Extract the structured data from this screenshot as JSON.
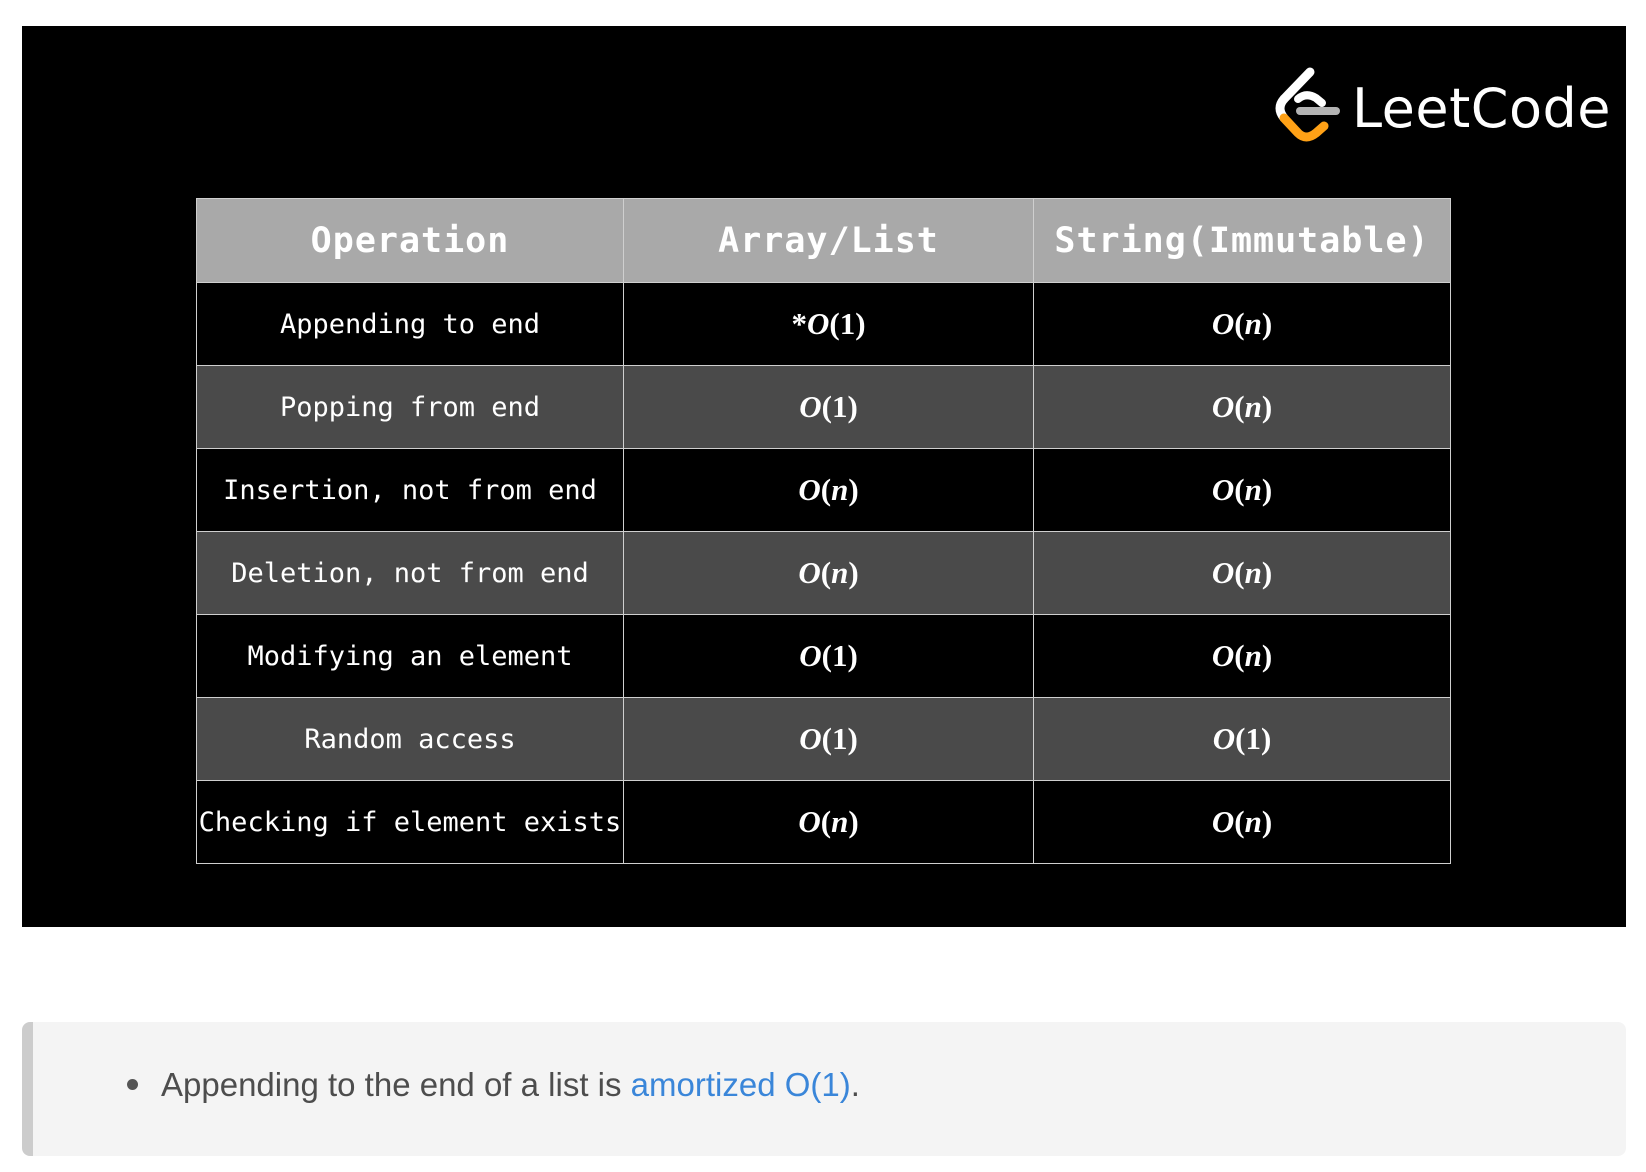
{
  "banner": {
    "logo_text": "LeetCode",
    "background": "#000000",
    "accent_orange": "#FFA116"
  },
  "table": {
    "headers": [
      "Operation",
      "Array/List",
      "String(Immutable)"
    ],
    "rows": [
      {
        "operation": "Appending to end",
        "array_prefix": "*",
        "array_o": "O",
        "array_arg": "1",
        "string_o": "O",
        "string_arg": "n"
      },
      {
        "operation": "Popping from end",
        "array_prefix": "",
        "array_o": "O",
        "array_arg": "1",
        "string_o": "O",
        "string_arg": "n"
      },
      {
        "operation": "Insertion, not from end",
        "array_prefix": "",
        "array_o": "O",
        "array_arg": "n",
        "string_o": "O",
        "string_arg": "n"
      },
      {
        "operation": "Deletion, not from end",
        "array_prefix": "",
        "array_o": "O",
        "array_arg": "n",
        "string_o": "O",
        "string_arg": "n"
      },
      {
        "operation": "Modifying an element",
        "array_prefix": "",
        "array_o": "O",
        "array_arg": "1",
        "string_o": "O",
        "string_arg": "n"
      },
      {
        "operation": "Random access",
        "array_prefix": "",
        "array_o": "O",
        "array_arg": "1",
        "string_o": "O",
        "string_arg": "1"
      },
      {
        "operation": "Checking if element exists",
        "array_prefix": "",
        "array_o": "O",
        "array_arg": "n",
        "string_o": "O",
        "string_arg": "n"
      }
    ],
    "header_bg": "#a9a9a9",
    "row_dark_bg": "#000000",
    "row_gray_bg": "#4a4a4a"
  },
  "note": {
    "bullet_text": "Appending to the end of a list is ",
    "link_text": "amortized O(1)",
    "trailing": ".",
    "link_color": "#3a86d9"
  }
}
